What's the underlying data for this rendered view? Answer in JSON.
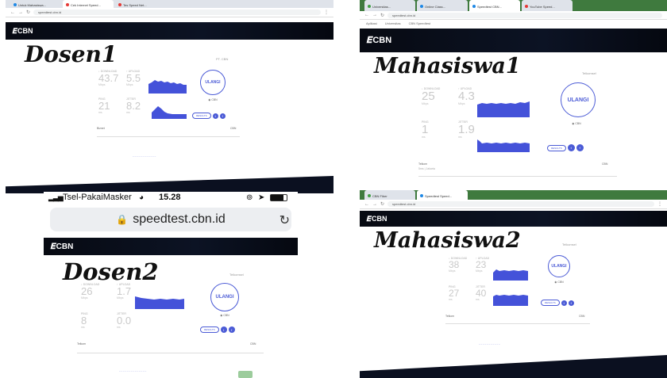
{
  "panels": [
    {
      "id": "p1",
      "label": "Dosen1",
      "tabs": [
        "Untuk Mahasiswa...",
        "Cek Internet Speed...",
        "Tes Speed Net..."
      ],
      "url": "speedtest.cbn.id",
      "isp": "PT. CBN",
      "download": "43.7",
      "upload": "5.5",
      "ping": "21",
      "jitter": "8.2",
      "again": "ULANGI",
      "host": "Biznet",
      "server": "CBN"
    },
    {
      "id": "p2",
      "label": "Mahasiswa1",
      "tabs": [
        "Universitas...",
        "Online Class...",
        "Speedtest CBN...",
        "YouTube Speed..."
      ],
      "url": "speedtest.cbn.id",
      "bookmarks": [
        "Aplikasi",
        "Universitas",
        "CBN Speedtest"
      ],
      "isp": "Telkomsel",
      "download": "25",
      "upload": "4.3",
      "ping": "1",
      "jitter": "1.9",
      "again": "ULANGI",
      "host": "Telkom",
      "server": "CBN",
      "status_line": "5ms  | Jakarta"
    },
    {
      "id": "p3",
      "label": "Dosen2",
      "carrier": "Tsel-PakaiMasker",
      "time": "15.28",
      "url": "speedtest.cbn.id",
      "isp": "Telkomsel",
      "download": "26",
      "upload": "1.7",
      "ping": "8",
      "jitter": "0.0",
      "again": "ULANGI",
      "host": "Telkom",
      "server": "CBN"
    },
    {
      "id": "p4",
      "label": "Mahasiswa2",
      "tabs": [
        "CBN Fiber",
        "Speedtest Speed..."
      ],
      "url": "speedtest.cbn.id",
      "isp": "Telkomsel",
      "download": "38",
      "upload": "23",
      "ping": "27",
      "jitter": "40",
      "again": "ULANGI",
      "host": "Telkom",
      "server": "CBN"
    }
  ],
  "logo_text": "CBN",
  "accent": "#4b5bd6",
  "graph_fill": "#4452d9"
}
